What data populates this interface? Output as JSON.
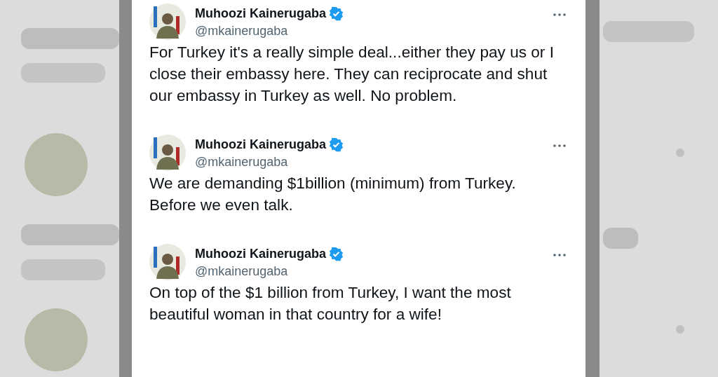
{
  "tweets": [
    {
      "name": "Muhoozi Kainerugaba",
      "verified": true,
      "handle": "@mkainerugaba",
      "text": "For Turkey it's a really simple deal...either they pay us or I close their embassy here. They can reciprocate and shut our embassy in Turkey as well. No problem."
    },
    {
      "name": "Muhoozi Kainerugaba",
      "verified": true,
      "handle": "@mkainerugaba",
      "text": "We are demanding $1billion (minimum) from Turkey. Before we even talk."
    },
    {
      "name": "Muhoozi Kainerugaba",
      "verified": true,
      "handle": "@mkainerugaba",
      "text": "On top of the $1 billion from Turkey, I want the most beautiful woman in that country for a wife!"
    }
  ]
}
